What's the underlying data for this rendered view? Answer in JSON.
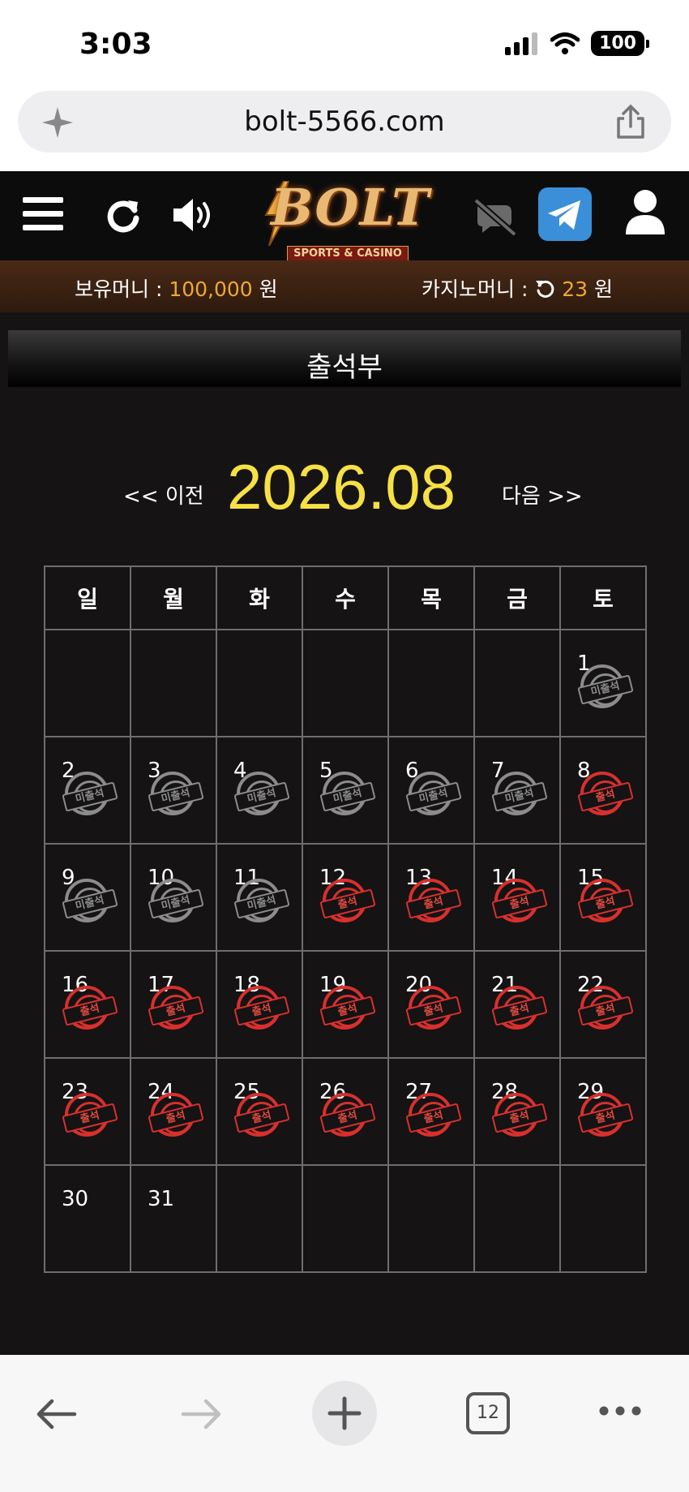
{
  "status": {
    "time": "3:03",
    "battery": "100"
  },
  "browser": {
    "url": "bolt-5566.com",
    "tab_count": "12"
  },
  "logo": {
    "name": "BOLT",
    "subtitle": "SPORTS & CASINO"
  },
  "money": {
    "holding_label": "보유머니 :",
    "holding_value": "100,000",
    "holding_unit": "원",
    "casino_label": "카지노머니 :",
    "casino_value": "23",
    "casino_unit": "원"
  },
  "page": {
    "title": "출석부"
  },
  "calendar": {
    "prev_label": "<< 이전",
    "next_label": "다음 >>",
    "month_title": "2026.08",
    "weekdays": [
      "일",
      "월",
      "화",
      "수",
      "목",
      "금",
      "토"
    ],
    "stamp_labels": {
      "absent": "미출석",
      "present": "출석"
    },
    "weeks": [
      [
        null,
        null,
        null,
        null,
        null,
        null,
        {
          "day": "1",
          "status": "absent"
        }
      ],
      [
        {
          "day": "2",
          "status": "absent"
        },
        {
          "day": "3",
          "status": "absent"
        },
        {
          "day": "4",
          "status": "absent"
        },
        {
          "day": "5",
          "status": "absent"
        },
        {
          "day": "6",
          "status": "absent"
        },
        {
          "day": "7",
          "status": "absent"
        },
        {
          "day": "8",
          "status": "present"
        }
      ],
      [
        {
          "day": "9",
          "status": "absent"
        },
        {
          "day": "10",
          "status": "absent"
        },
        {
          "day": "11",
          "status": "absent"
        },
        {
          "day": "12",
          "status": "present"
        },
        {
          "day": "13",
          "status": "present"
        },
        {
          "day": "14",
          "status": "present"
        },
        {
          "day": "15",
          "status": "present"
        }
      ],
      [
        {
          "day": "16",
          "status": "present"
        },
        {
          "day": "17",
          "status": "present"
        },
        {
          "day": "18",
          "status": "present"
        },
        {
          "day": "19",
          "status": "present"
        },
        {
          "day": "20",
          "status": "present"
        },
        {
          "day": "21",
          "status": "present"
        },
        {
          "day": "22",
          "status": "present"
        }
      ],
      [
        {
          "day": "23",
          "status": "present"
        },
        {
          "day": "24",
          "status": "present"
        },
        {
          "day": "25",
          "status": "present"
        },
        {
          "day": "26",
          "status": "present"
        },
        {
          "day": "27",
          "status": "present"
        },
        {
          "day": "28",
          "status": "present"
        },
        {
          "day": "29",
          "status": "present"
        }
      ],
      [
        {
          "day": "30",
          "status": "none"
        },
        {
          "day": "31",
          "status": "none"
        },
        null,
        null,
        null,
        null,
        null
      ]
    ]
  },
  "colors": {
    "month_title": "#f6e044",
    "money_accent": "#f0a830",
    "present_stamp": "#d8302d",
    "absent_stamp": "#8c8c8c",
    "telegram": "#3a8fd8"
  },
  "icons": [
    "menu-icon",
    "refresh-icon",
    "volume-icon",
    "chat-off-icon",
    "telegram-icon",
    "user-icon",
    "sparkle-icon",
    "share-icon",
    "back-icon",
    "forward-icon",
    "plus-icon",
    "more-icon"
  ]
}
